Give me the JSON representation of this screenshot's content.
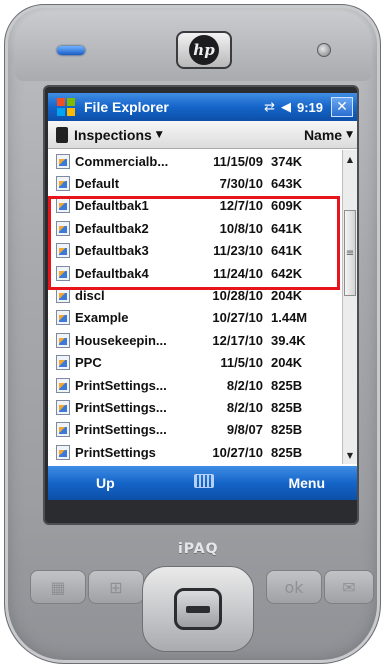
{
  "device": {
    "brand_logo": "hp",
    "model_label": "iPAQ"
  },
  "title_bar": {
    "title": "File Explorer",
    "connectivity_icon": "sync-arrows-icon",
    "volume_icon": "speaker-icon",
    "time": "9:19",
    "close_label": "✕"
  },
  "header": {
    "folder": "Inspections",
    "sort": "Name"
  },
  "files": [
    {
      "name": "Commercialb...",
      "date": "11/15/09",
      "size": "374K"
    },
    {
      "name": "Default",
      "date": "7/30/10",
      "size": "643K"
    },
    {
      "name": "Defaultbak1",
      "date": "12/7/10",
      "size": "609K"
    },
    {
      "name": "Defaultbak2",
      "date": "10/8/10",
      "size": "641K"
    },
    {
      "name": "Defaultbak3",
      "date": "11/23/10",
      "size": "641K"
    },
    {
      "name": "Defaultbak4",
      "date": "11/24/10",
      "size": "642K"
    },
    {
      "name": "discl",
      "date": "10/28/10",
      "size": "204K"
    },
    {
      "name": "Example",
      "date": "10/27/10",
      "size": "1.44M"
    },
    {
      "name": "Housekeepin...",
      "date": "12/17/10",
      "size": "39.4K"
    },
    {
      "name": "PPC",
      "date": "11/5/10",
      "size": "204K"
    },
    {
      "name": "PrintSettings...",
      "date": "8/2/10",
      "size": "825B"
    },
    {
      "name": "PrintSettings...",
      "date": "8/2/10",
      "size": "825B"
    },
    {
      "name": "PrintSettings...",
      "date": "9/8/07",
      "size": "825B"
    },
    {
      "name": "PrintSettings",
      "date": "10/27/10",
      "size": "825B"
    }
  ],
  "softkeys": {
    "left": "Up",
    "right": "Menu"
  },
  "colors": {
    "title_bar": "#1565c9",
    "highlight": "#e8141c"
  }
}
